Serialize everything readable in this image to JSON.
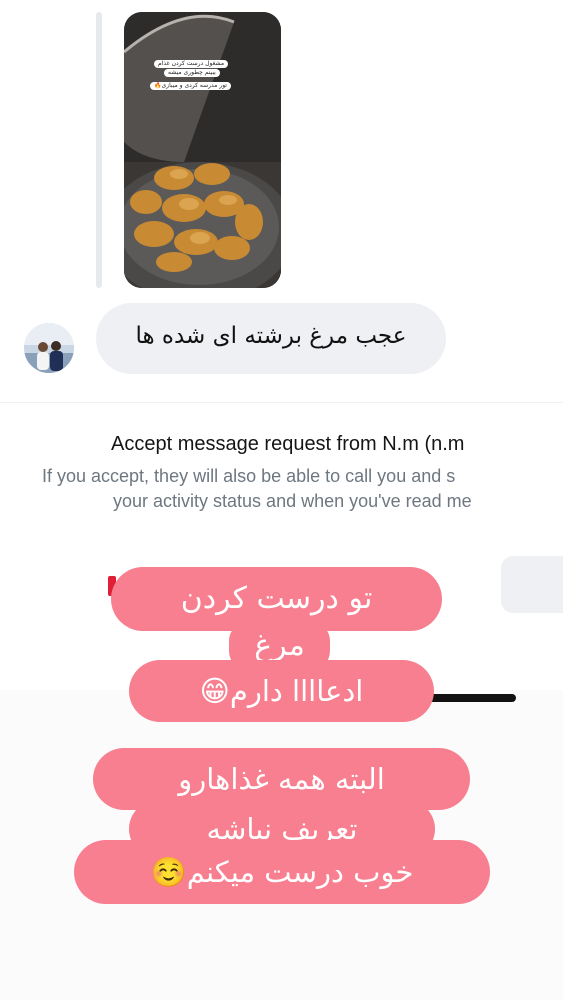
{
  "story": {
    "caption_line1": "مشغول درست کردن غذام",
    "caption_line2": "ببینم چطوری میشه",
    "caption_line3": "تور مدرسه کردی و میبازی🔥"
  },
  "incoming_message": {
    "text": "عجب مرغ برشته ای شده ها"
  },
  "request": {
    "title": "Accept message request from N.m (n.m",
    "line1": "If you accept, they will also be able to call you and s",
    "line2": "your activity status and when you've read me"
  },
  "stickers": {
    "line1": "تو درست کردن",
    "line2": "مرغ",
    "line3": "ادعاااا دارم😁",
    "line4": "البته همه غذاهارو",
    "line5": "تعریف نباشه",
    "line6": "خوب درست میکنم☺️"
  }
}
